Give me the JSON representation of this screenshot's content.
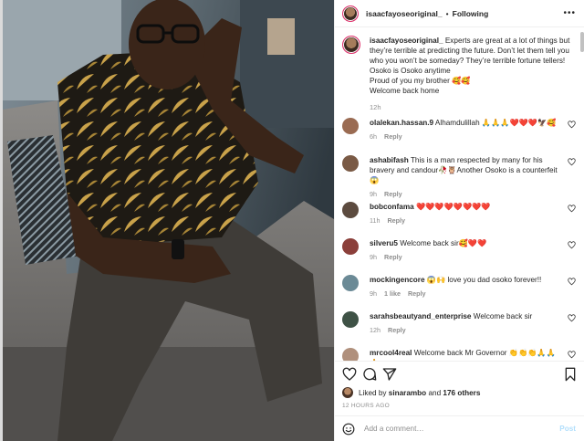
{
  "post": {
    "username": "isaacfayoseoriginal_",
    "separator": "•",
    "follow_label": "Following",
    "more_label": "•••",
    "caption_lines": [
      "Experts are great at a lot of things but they’re terrible at predicting the future. Don’t let them tell you who you won’t be someday? They’re terrible fortune tellers!",
      "Osoko is Osoko anytime",
      "Proud of you my brother 🥰🥰",
      "Welcome back home"
    ],
    "caption_time": "12h"
  },
  "comments": [
    {
      "user": "olalekan.hassan.9",
      "text": "Alhamdulillah 🙏🙏🙏❤️❤️❤️🦅🥰",
      "time": "6h",
      "likes": "",
      "reply": "Reply",
      "avatar_color": "#9a6b52"
    },
    {
      "user": "ashabifash",
      "text": "This is a man respected by many for his bravery and candour🥀🦉Another Osoko is a counterfeit 😱",
      "time": "9h",
      "likes": "",
      "reply": "Reply",
      "avatar_color": "#7a5a45"
    },
    {
      "user": "bobconfama",
      "text": "❤️❤️❤️❤️❤️❤️❤️❤️",
      "time": "11h",
      "likes": "",
      "reply": "Reply",
      "avatar_color": "#5c4b3f"
    },
    {
      "user": "silveru5",
      "text": "Welcome back sir🥰❤️❤️",
      "time": "9h",
      "likes": "",
      "reply": "Reply",
      "avatar_color": "#8b3f3a"
    },
    {
      "user": "mockingencore",
      "text": "😱🙌 love you dad osoko forever!!",
      "time": "9h",
      "likes": "1 like",
      "reply": "Reply",
      "avatar_color": "#6b8a96"
    },
    {
      "user": "sarahsbeautyand_enterprise",
      "text": "Welcome back sir",
      "time": "12h",
      "likes": "",
      "reply": "Reply",
      "avatar_color": "#3f5246"
    },
    {
      "user": "mrcool4real",
      "text": "Welcome back Mr Governor 👏👏👏🙏🙏🙏",
      "time": "",
      "likes": "",
      "reply": "",
      "avatar_color": "#b0907c"
    }
  ],
  "actions": {
    "icons": [
      "heart-icon",
      "comment-icon",
      "share-icon",
      "bookmark-icon"
    ]
  },
  "likes": {
    "prefix": "Liked by",
    "user": "sinarambo",
    "and": "and",
    "others": "176 others"
  },
  "time_ago": "12 HOURS AGO",
  "add_comment": {
    "placeholder": "Add a comment…",
    "post_label": "Post"
  },
  "colors": {
    "post_disabled": "#b2dffc",
    "muted": "#8e8e8e",
    "text": "#262626",
    "border": "#efefef"
  }
}
